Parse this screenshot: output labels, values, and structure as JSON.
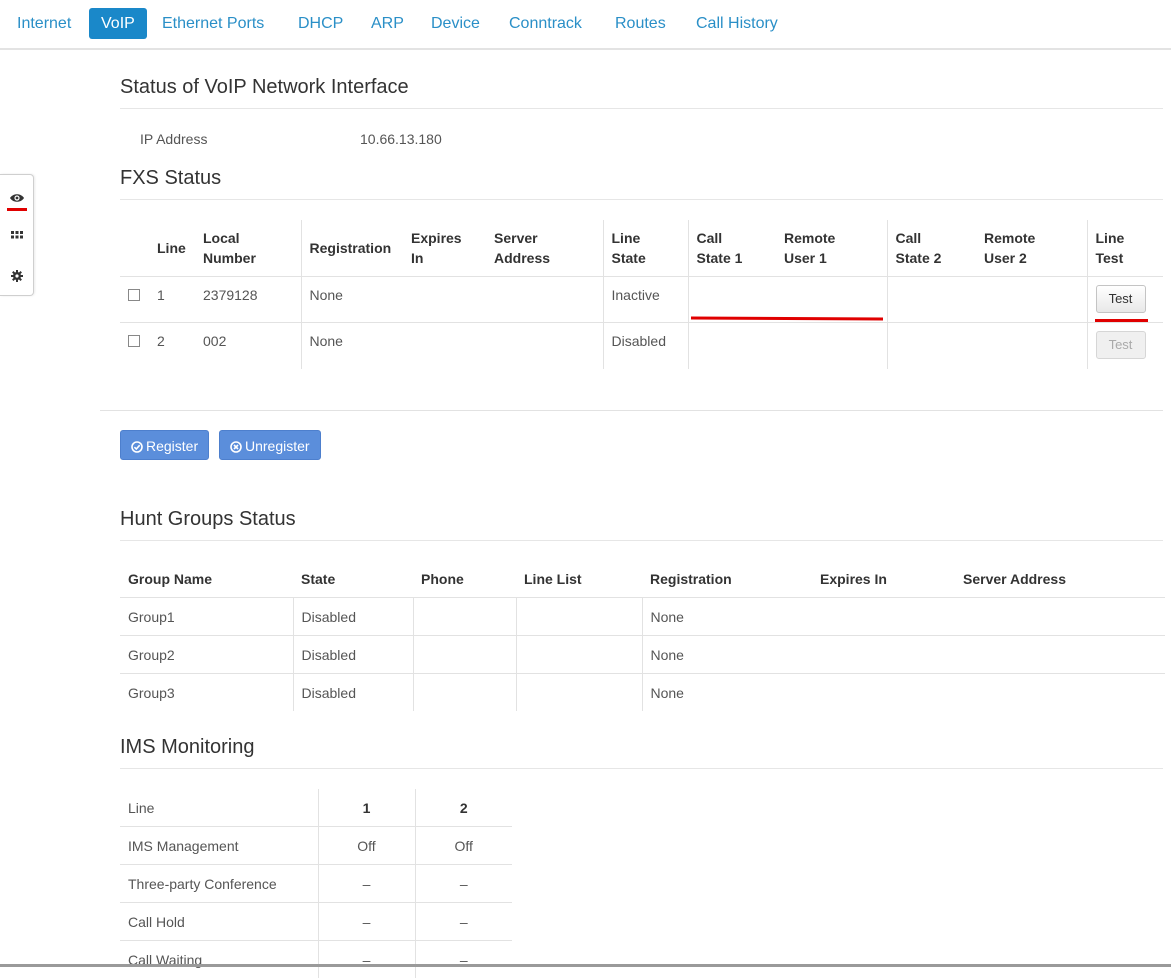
{
  "nav": {
    "tabs": [
      {
        "label": "Internet"
      },
      {
        "label": "VoIP",
        "active": true
      },
      {
        "label": "Ethernet Ports"
      },
      {
        "label": "DHCP"
      },
      {
        "label": "ARP"
      },
      {
        "label": "Device"
      },
      {
        "label": "Conntrack"
      },
      {
        "label": "Routes"
      },
      {
        "label": "Call History"
      }
    ]
  },
  "sidebar": {
    "icons": [
      "eye-icon",
      "grid-icon",
      "gear-icon"
    ]
  },
  "voip_status": {
    "title": "Status of VoIP Network Interface",
    "ip_label": "IP Address",
    "ip_value": "10.66.13.180"
  },
  "fxs": {
    "title": "FXS Status",
    "headers": {
      "line": "Line",
      "local_number_1": "Local",
      "local_number_2": "Number",
      "registration": "Registration",
      "expires_1": "Expires",
      "expires_2": "In",
      "server_1": "Server",
      "server_2": "Address",
      "line_state_1": "Line",
      "line_state_2": "State",
      "call_state1_1": "Call",
      "call_state1_2": "State 1",
      "remote1_1": "Remote",
      "remote1_2": "User 1",
      "call_state2_1": "Call",
      "call_state2_2": "State 2",
      "remote2_1": "Remote",
      "remote2_2": "User 2",
      "line_test_1": "Line",
      "line_test_2": "Test"
    },
    "rows": [
      {
        "line": "1",
        "local_number": "2379128",
        "registration": "None",
        "expires": "",
        "server": "",
        "line_state": "Inactive",
        "call_state1": "",
        "remote1": "",
        "call_state2": "",
        "remote2": "",
        "test_label": "Test",
        "test_enabled": true
      },
      {
        "line": "2",
        "local_number": "002",
        "registration": "None",
        "expires": "",
        "server": "",
        "line_state": "Disabled",
        "call_state1": "",
        "remote1": "",
        "call_state2": "",
        "remote2": "",
        "test_label": "Test",
        "test_enabled": false
      }
    ],
    "register_label": "Register",
    "unregister_label": "Unregister"
  },
  "hunt": {
    "title": "Hunt Groups Status",
    "headers": {
      "group_name": "Group Name",
      "state": "State",
      "phone": "Phone",
      "line_list": "Line List",
      "registration": "Registration",
      "expires_in": "Expires In",
      "server_address": "Server Address"
    },
    "rows": [
      {
        "group_name": "Group1",
        "state": "Disabled",
        "phone": "",
        "line_list": "",
        "registration": "None",
        "expires_in": "",
        "server_address": ""
      },
      {
        "group_name": "Group2",
        "state": "Disabled",
        "phone": "",
        "line_list": "",
        "registration": "None",
        "expires_in": "",
        "server_address": ""
      },
      {
        "group_name": "Group3",
        "state": "Disabled",
        "phone": "",
        "line_list": "",
        "registration": "None",
        "expires_in": "",
        "server_address": ""
      }
    ]
  },
  "ims": {
    "title": "IMS Monitoring",
    "header": {
      "label": "Line",
      "col1": "1",
      "col2": "2"
    },
    "rows": [
      {
        "label": "IMS Management",
        "col1": "Off",
        "col2": "Off"
      },
      {
        "label": "Three-party Conference",
        "col1": "–",
        "col2": "–"
      },
      {
        "label": "Call Hold",
        "col1": "–",
        "col2": "–"
      },
      {
        "label": "Call Waiting",
        "col1": "–",
        "col2": "–"
      }
    ]
  },
  "colors": {
    "accent": "#1a88c9",
    "nav_text": "#2a8fc7",
    "button_blue": "#5b8edb",
    "highlight_red": "#e00000"
  }
}
